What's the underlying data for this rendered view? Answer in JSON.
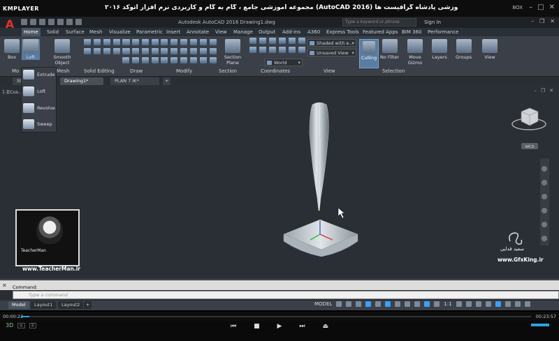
{
  "player": {
    "logo": "KMPLAYER",
    "title": "مجموعه آموزشی جامع ، گام به گام و کاربردی نرم افزار  اتوکد ۲۰۱۶ (AutoCAD 2016)  مدرس : سعید فدایی (تیچرمن) گروه آموزشی پادشاه گرافیست ها",
    "box_label": "BOX",
    "time_current": "00:00:22",
    "time_total": "00:23:57",
    "progress_fraction": 0.016,
    "controls": [
      "prev",
      "stop",
      "play",
      "next",
      "eject"
    ]
  },
  "app": {
    "title": "Autodesk AutoCAD 2016    Drawing1.dwg",
    "search_placeholder": "Type a keyword or phrase",
    "sign_in": "Sign In"
  },
  "ribbon_tabs": [
    "Home",
    "Solid",
    "Surface",
    "Mesh",
    "Visualize",
    "Parametric",
    "Insert",
    "Annotate",
    "View",
    "Manage",
    "Output",
    "Add-ins",
    "A360",
    "Express Tools",
    "Featured Apps",
    "BIM 360",
    "Performance"
  ],
  "ribbon": {
    "modeling_label": "Mo",
    "box_label": "Box",
    "loft_label": "Loft",
    "smooth_object_label": "Smooth Object",
    "mesh_label": "Mesh",
    "solid_editing_label": "Solid Editing",
    "draw_label": "Draw",
    "modify_label": "Modify",
    "section_plane_label": "Section Plane",
    "section_label": "Section",
    "coordinates_label": "Coordinates",
    "world_label": "World",
    "visual_style": "Shaded with e...",
    "view_combo": "Unsaved View",
    "view_label": "View",
    "culling_label": "Culling",
    "no_filter_label": "No Filter",
    "move_gizmo_label": "Move Gizmo",
    "selection_label": "Selection",
    "layers_label": "Layers",
    "groups_label": "Groups",
    "view_btn_label": "View"
  },
  "loft_menu": [
    "Extrude",
    "Loft",
    "Revolve",
    "Sweep"
  ],
  "file_tabs": [
    "St",
    "Drawing1*",
    "PLAN 7 IK*"
  ],
  "viewport": {
    "label": "[-][Cus...          d with edges]",
    "viewcube_label": "WCS"
  },
  "watermark": {
    "left_text": "TeacherMan",
    "left_url": "www.TeacherMan.ir",
    "right_name": "سعید فدایی",
    "right_url": "www.GfxKing.ir"
  },
  "command": {
    "history": "Command:",
    "placeholder": "Type a command"
  },
  "layout_tabs": [
    "Model",
    "Layout1",
    "Layout2"
  ],
  "status": {
    "model_label": "MODEL",
    "scale": "1:1"
  },
  "colors": {
    "accent": "#29a3e8",
    "viewport_bg": "#2a2f36",
    "ribbon_bg": "#3b4048"
  }
}
